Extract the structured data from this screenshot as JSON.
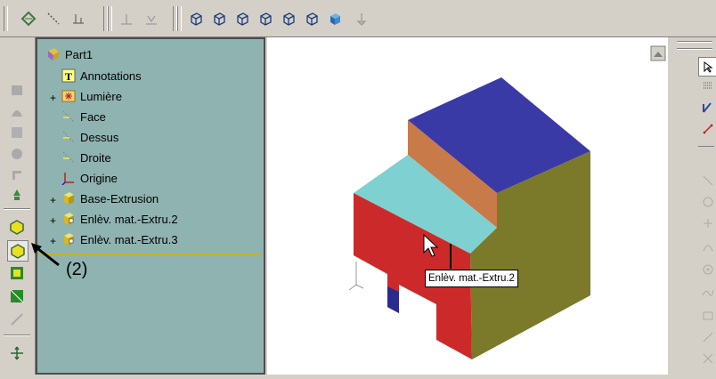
{
  "toolbar": {
    "icons": [
      "sketch-icon",
      "line-icon",
      "smart-dimension-icon",
      "plane-icon",
      "relation-icon",
      "view-iso-icon",
      "view-top-icon",
      "view-front-icon",
      "view-right-icon",
      "view-left-icon",
      "view-back-icon",
      "view-shaded-icon",
      "normal-to-icon"
    ]
  },
  "feature_tree": {
    "root": "Part1",
    "items": [
      {
        "label": "Annotations",
        "expandable": false
      },
      {
        "label": "Lumière",
        "expandable": true
      },
      {
        "label": "Face",
        "expandable": false
      },
      {
        "label": "Dessus",
        "expandable": false
      },
      {
        "label": "Droite",
        "expandable": false
      },
      {
        "label": "Origine",
        "expandable": false
      },
      {
        "label": "Base-Extrusion",
        "expandable": true
      },
      {
        "label": "Enlèv. mat.-Extru.2",
        "expandable": true
      },
      {
        "label": "Enlèv. mat.-Extru.3",
        "expandable": true
      }
    ]
  },
  "tooltip": "Enlèv. mat.-Extru.2",
  "annotation": "(2)",
  "model_colors": {
    "top": "#3a3aa6",
    "riser": "#c87a48",
    "step": "#7fd0d0",
    "front": "#cc2a2a",
    "side": "#7a7a2a"
  }
}
